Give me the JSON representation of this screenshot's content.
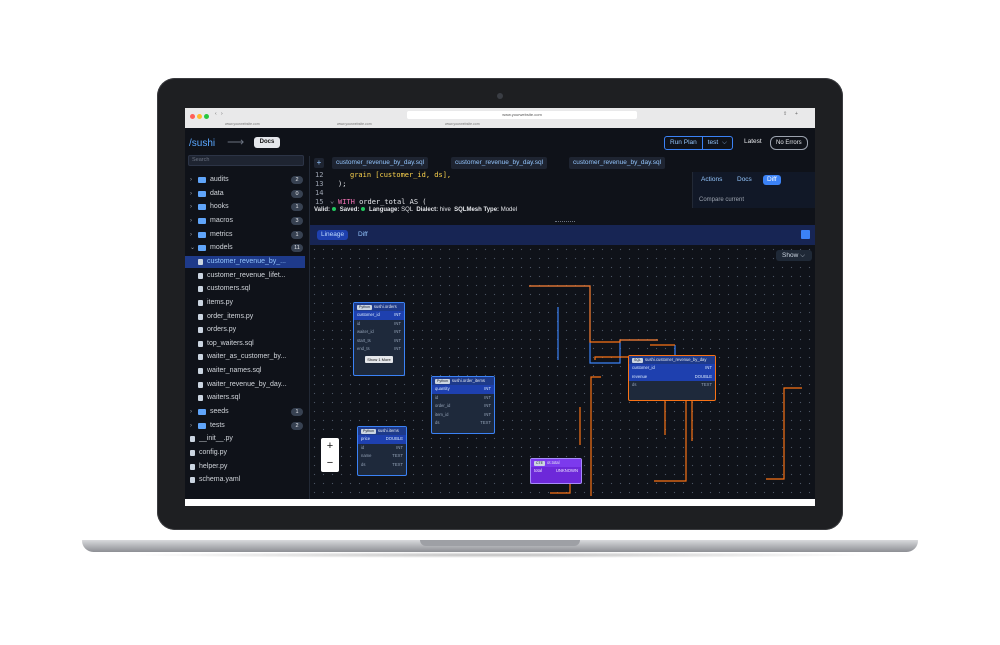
{
  "browser": {
    "url": "www.yourwebsite.com",
    "tabs": [
      "www.yourwebsite.com",
      "www.yourwebsite.com",
      "www.yourwebsite.com"
    ]
  },
  "header": {
    "brand": "/sushi",
    "arrow": "⟶",
    "docs": "Docs",
    "run_plan": "Run Plan",
    "env": "test",
    "env_caret": "⌵",
    "latest": "Latest",
    "errors": "No Errors"
  },
  "sidebar": {
    "search_placeholder": "Search",
    "items": [
      {
        "label": "audits",
        "type": "folder",
        "count": "2",
        "expanded": false
      },
      {
        "label": "data",
        "type": "folder",
        "count": "0",
        "expanded": false
      },
      {
        "label": "hooks",
        "type": "folder",
        "count": "1",
        "expanded": false
      },
      {
        "label": "macros",
        "type": "folder",
        "count": "3",
        "expanded": false
      },
      {
        "label": "metrics",
        "type": "folder",
        "count": "1",
        "expanded": false
      },
      {
        "label": "models",
        "type": "folder",
        "count": "11",
        "expanded": true
      },
      {
        "label": "customer_revenue_by_...",
        "type": "file",
        "depth": 1,
        "active": true
      },
      {
        "label": "customer_revenue_lifet...",
        "type": "file",
        "depth": 1
      },
      {
        "label": "customers.sql",
        "type": "file",
        "depth": 1
      },
      {
        "label": "items.py",
        "type": "file",
        "depth": 1
      },
      {
        "label": "order_items.py",
        "type": "file",
        "depth": 1
      },
      {
        "label": "orders.py",
        "type": "file",
        "depth": 1
      },
      {
        "label": "top_waiters.sql",
        "type": "file",
        "depth": 1
      },
      {
        "label": "waiter_as_customer_by...",
        "type": "file",
        "depth": 1
      },
      {
        "label": "waiter_names.sql",
        "type": "file",
        "depth": 1
      },
      {
        "label": "waiter_revenue_by_day...",
        "type": "file",
        "depth": 1
      },
      {
        "label": "waiters.sql",
        "type": "file",
        "depth": 1
      },
      {
        "label": "seeds",
        "type": "folder",
        "count": "1",
        "expanded": false
      },
      {
        "label": "tests",
        "type": "folder",
        "count": "2",
        "expanded": false
      },
      {
        "label": "__init__.py",
        "type": "file",
        "depth": 0
      },
      {
        "label": "config.py",
        "type": "file",
        "depth": 0
      },
      {
        "label": "helper.py",
        "type": "file",
        "depth": 0
      },
      {
        "label": "schema.yaml",
        "type": "file",
        "depth": 0
      }
    ]
  },
  "editor": {
    "add_tab": "+",
    "tabs": [
      "customer_revenue_by_day.sql",
      "customer_revenue_by_day.sql",
      "customer_revenue_by_day.sql"
    ],
    "lines": [
      {
        "n": "12",
        "text": "grain [customer_id, ds],"
      },
      {
        "n": "13",
        "text": ");"
      },
      {
        "n": "14",
        "text": ""
      },
      {
        "n": "15",
        "kw": "WITH",
        "text": " order_total AS ("
      }
    ],
    "fold": "⌄",
    "status": {
      "valid": "Valid:",
      "saved": "Saved:",
      "language_label": "Language:",
      "language": "SQL",
      "dialect_label": "Dialect:",
      "dialect": "hive",
      "type_label": "SQLMesh Type:",
      "type": "Model"
    },
    "right_tabs": [
      "Actions",
      "Docs",
      "Diff"
    ],
    "compare_text": "Compare current"
  },
  "lineage": {
    "tabs": [
      "Lineage",
      "Diff"
    ],
    "show": "Show",
    "show_caret": "⌵",
    "zoom_in": "+",
    "zoom_out": "−",
    "nodes": {
      "orders": {
        "badge": "Python",
        "title": "sushi.orders",
        "rows": [
          [
            "customer_id",
            "INT"
          ],
          [
            "id",
            "INT"
          ],
          [
            "waiter_id",
            "INT"
          ],
          [
            "start_ts",
            "INT"
          ],
          [
            "end_ts",
            "INT"
          ]
        ],
        "more": "Show 1 More"
      },
      "order_items": {
        "badge": "Python",
        "title": "sushi.order_items",
        "rows": [
          [
            "quantity",
            "INT"
          ],
          [
            "id",
            "INT"
          ],
          [
            "order_id",
            "INT"
          ],
          [
            "item_id",
            "INT"
          ],
          [
            "ds",
            "TEXT"
          ]
        ]
      },
      "items": {
        "badge": "Python",
        "title": "sushi.items",
        "rows": [
          [
            "price",
            "DOUBLE"
          ],
          [
            "id",
            "INT"
          ],
          [
            "name",
            "TEXT"
          ],
          [
            "ds",
            "TEXT"
          ]
        ]
      },
      "revenue": {
        "badge": "SQL",
        "title": "sushi.customer_revenue_by_day",
        "rows": [
          [
            "customer_id",
            "INT"
          ],
          [
            "revenue",
            "DOUBLE"
          ],
          [
            "ds",
            "TEXT"
          ]
        ]
      },
      "ot": {
        "badge": "CTE",
        "title": "ot.total",
        "rows": [
          [
            "total",
            "UNKNOWN"
          ]
        ]
      }
    }
  }
}
